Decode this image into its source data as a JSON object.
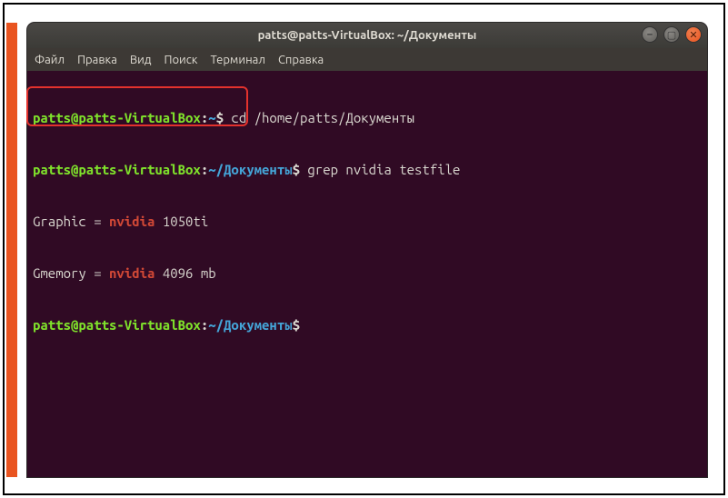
{
  "window": {
    "title": "patts@patts-VirtualBox: ~/Документы"
  },
  "menubar": {
    "file": "Файл",
    "edit": "Правка",
    "view": "Вид",
    "search": "Поиск",
    "terminal": "Терминал",
    "help": "Справка"
  },
  "prompt": {
    "user_host": "patts@patts-VirtualBox",
    "colon": ":",
    "tilde": "~",
    "path": "~/Документы",
    "dollar": "$"
  },
  "lines": {
    "l1_cmd": " cd /home/patts/Документы",
    "l2_cmd": " grep nvidia testfile",
    "l3_pre": "Graphic = ",
    "l3_match": "nvidia",
    "l3_post": " 1050ti",
    "l4_pre": "Gmemory = ",
    "l4_match": "nvidia",
    "l4_post": " 4096 mb",
    "l5_cmd": " "
  },
  "icons": {
    "minimize": "–",
    "maximize": "▢",
    "close": "✕"
  }
}
